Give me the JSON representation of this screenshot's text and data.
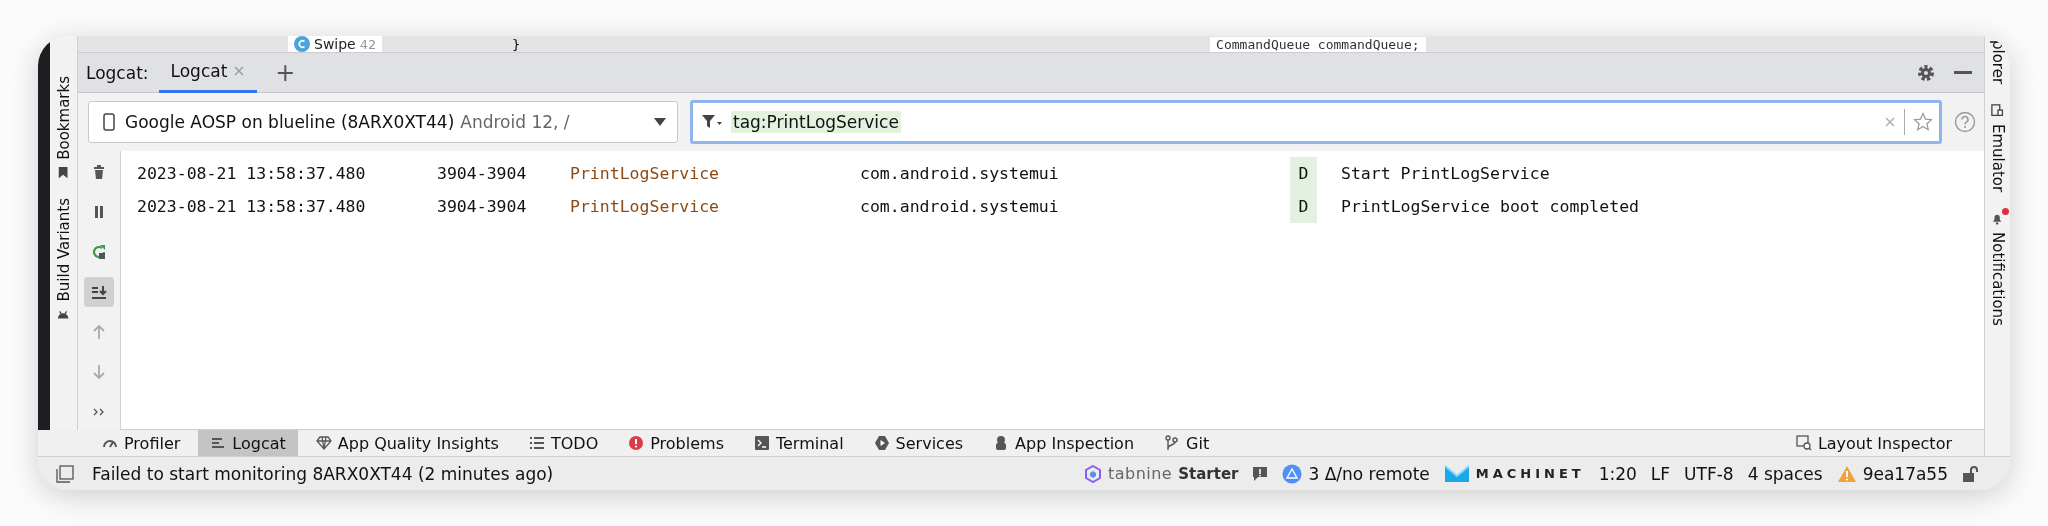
{
  "editor_strip": {
    "class_name": "Swipe",
    "line_number": "42",
    "brace": "}",
    "code": "CommandQueue commandQueue;"
  },
  "left_stripe": [
    {
      "label": "Bookmarks",
      "kind": "bookmark"
    },
    {
      "label": "Build Variants",
      "kind": "android"
    }
  ],
  "logcat_header": {
    "title": "Logcat:",
    "tabs": [
      {
        "label": "Logcat",
        "selected": true,
        "closable": true
      }
    ],
    "add": "+"
  },
  "device_dropdown": {
    "device": "Google AOSP on blueline (8ARX0XT44)",
    "detail": "Android 12, /"
  },
  "filter": {
    "value": "tag:PrintLogService"
  },
  "toolbar": [
    {
      "kind": "clear",
      "selected": false,
      "disabled": false
    },
    {
      "kind": "pause",
      "selected": false,
      "disabled": false
    },
    {
      "kind": "restart",
      "selected": false,
      "disabled": false
    },
    {
      "kind": "scroll-end",
      "selected": true,
      "disabled": false
    },
    {
      "kind": "up",
      "selected": false,
      "disabled": true
    },
    {
      "kind": "down",
      "selected": false,
      "disabled": true
    },
    {
      "kind": "more",
      "selected": false,
      "disabled": false
    }
  ],
  "log_rows": [
    {
      "timestamp": "2023-08-21 13:58:37.480",
      "pid": "3904-3904",
      "tag": "PrintLogService",
      "package": "com.android.systemui",
      "level": "D",
      "message": "Start PrintLogService"
    },
    {
      "timestamp": "2023-08-21 13:58:37.480",
      "pid": "3904-3904",
      "tag": "PrintLogService",
      "package": "com.android.systemui",
      "level": "D",
      "message": "PrintLogService boot completed"
    }
  ],
  "right_stripe": [
    {
      "label": "plorer",
      "kind": "none",
      "badge": false
    },
    {
      "label": "Emulator",
      "kind": "emulator",
      "badge": false
    },
    {
      "label": "Notifications",
      "kind": "bell",
      "badge": true
    }
  ],
  "bottom_tabs": [
    {
      "label": "Profiler",
      "kind": "profiler",
      "selected": false
    },
    {
      "label": "Logcat",
      "kind": "logcat",
      "selected": true
    },
    {
      "label": "App Quality Insights",
      "kind": "diamond",
      "selected": false
    },
    {
      "label": "TODO",
      "kind": "list",
      "selected": false
    },
    {
      "label": "Problems",
      "kind": "error",
      "selected": false
    },
    {
      "label": "Terminal",
      "kind": "terminal",
      "selected": false
    },
    {
      "label": "Services",
      "kind": "services",
      "selected": false
    },
    {
      "label": "App Inspection",
      "kind": "inspection",
      "selected": false
    },
    {
      "label": "Git",
      "kind": "git",
      "selected": false
    }
  ],
  "bottom_tabs_right": [
    {
      "label": "Layout Inspector",
      "kind": "layout",
      "selected": false
    }
  ],
  "status_bar": {
    "message": "Failed to start monitoring 8ARX0XT44 (2 minutes ago)",
    "tabnine": "tabnine",
    "tabnine_plan": "Starter",
    "vcs": "3 Δ/no remote",
    "machinet": "MACHINET",
    "position": "1:20",
    "line_ending": "LF",
    "encoding": "UTF-8",
    "indent": "4 spaces",
    "commit": "9ea17a55"
  }
}
